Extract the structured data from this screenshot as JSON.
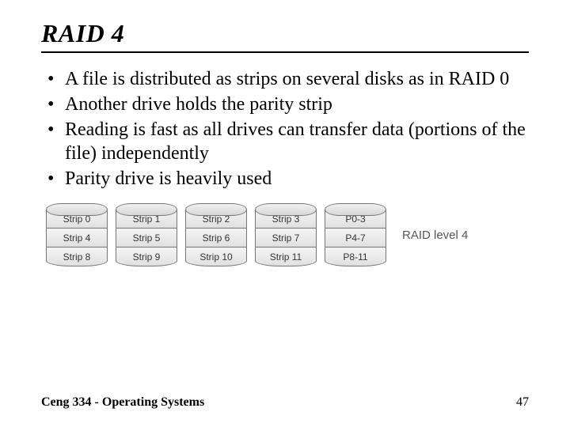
{
  "title": "RAID 4",
  "bullets": [
    "A file is distributed as strips on several disks as in RAID 0",
    "Another drive holds the parity strip",
    "Reading is fast as all drives can transfer data (portions of the file) independently",
    "Parity drive is heavily used"
  ],
  "diagram": {
    "label": "RAID level 4",
    "disks": [
      {
        "strips": [
          "Strip 0",
          "Strip 4",
          "Strip 8"
        ]
      },
      {
        "strips": [
          "Strip 1",
          "Strip 5",
          "Strip 9"
        ]
      },
      {
        "strips": [
          "Strip 2",
          "Strip 6",
          "Strip 10"
        ]
      },
      {
        "strips": [
          "Strip 3",
          "Strip 7",
          "Strip 11"
        ]
      },
      {
        "strips": [
          "P0-3",
          "P4-7",
          "P8-11"
        ]
      }
    ]
  },
  "footer": {
    "left": "Ceng 334 - Operating Systems",
    "page": "47"
  }
}
